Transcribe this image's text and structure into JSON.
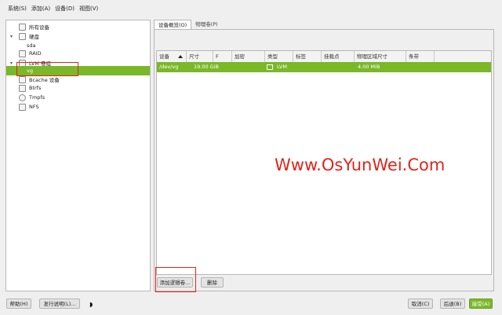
{
  "menu": [
    "系统(S)",
    "添加(A)",
    "设备(D)",
    "视图(V)"
  ],
  "tree": {
    "all_devices": "所有设备",
    "disks": "硬盘",
    "sda": "sda",
    "raid": "RAID",
    "lvm_group": "LVM 卷组",
    "vg": "vg",
    "bcache": "Bcache 设备",
    "btrfs": "Btrfs",
    "tmpfs": "Tmpfs",
    "nfs": "NFS"
  },
  "tabs": [
    "设备概览(O)",
    "物理卷(P)"
  ],
  "table": {
    "headers": [
      "设备",
      "尺寸",
      "F",
      "加密",
      "类型",
      "标签",
      "挂载点",
      "物理区域尺寸",
      "条带"
    ],
    "row": {
      "device": "/dev/vg",
      "size": "19.00 GiB",
      "f": "",
      "encrypt": "",
      "type": "LVM",
      "label": "",
      "mount": "",
      "pe_size": "4.00 MiB",
      "stripes": ""
    }
  },
  "panel_buttons": {
    "add_lv": "添加逻辑卷...",
    "delete": "删除"
  },
  "footer": {
    "help": "帮助(H)",
    "release_notes": "发行说明(L)...",
    "cancel": "取消(C)",
    "back": "后退(B)",
    "accept": "接受(A)"
  },
  "watermark": "Www.OsYunWei.Com",
  "colors": {
    "accent": "#7ab829",
    "highlight_box": "#e2231a"
  }
}
